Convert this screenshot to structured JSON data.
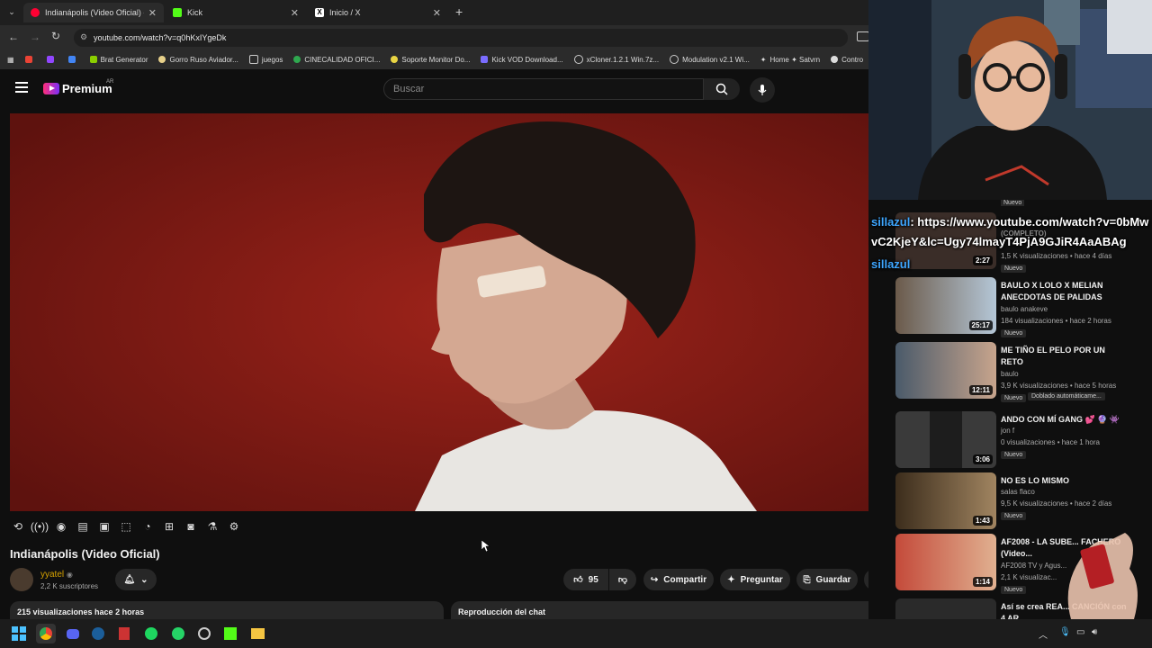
{
  "browser": {
    "tabs": [
      {
        "label": "Indianápolis (Video Oficial) - Yo",
        "active": true
      },
      {
        "label": "Kick",
        "active": false
      },
      {
        "label": "Inicio / X",
        "active": false
      }
    ],
    "url": "youtube.com/watch?v=q0hKxIYgeDk",
    "bookmarks": [
      "Brat Generator",
      "Gorro Ruso Aviador...",
      "juegos",
      "CINECALIDAD OFICI...",
      "Soporte Monitor Do...",
      "Kick VOD Download...",
      "xCloner.1.2.1 Win.7z...",
      "Modulation v2.1 Wi...",
      "Home ✦ Satvrn",
      "Contro"
    ]
  },
  "youtube": {
    "logo_text": "Premium",
    "region": "AR",
    "search_placeholder": "Buscar"
  },
  "video": {
    "title": "Indianápolis (Video Oficial)",
    "channel": "yyatel",
    "subscribers": "2,2 K suscriptores",
    "likes": "95",
    "share_label": "Compartir",
    "ask_label": "Preguntar",
    "save_label": "Guardar",
    "views_time": "215 visualizaciones  hace 2 horas",
    "chat_replay": "Reproducción del chat"
  },
  "chat_overlay": {
    "user": "sillazul",
    "message": ": https://www.youtube.com/watch?v=0bMwvC2KjeY&lc=Ugy74lmayT4PjA9GJiR4AaABAg",
    "user2": "sillazul"
  },
  "recommendations": [
    {
      "title": "",
      "channel": "",
      "meta": "1,5 K visualizaciones • hace 4 días",
      "duration": "2:27",
      "badge": "Nuevo",
      "partial_title": "(COMPLETO)"
    },
    {
      "title": "BAULO X LOLO X MELIAN ANECDOTAS DE PALIDAS",
      "channel": "baulo anakeve",
      "meta": "184 visualizaciones • hace 2 horas",
      "duration": "25:17",
      "badge": "Nuevo"
    },
    {
      "title": "ME TIÑO EL PELO POR UN RETO",
      "channel": "baulo",
      "meta": "3,9 K visualizaciones • hace 5 horas",
      "duration": "12:11",
      "badge": "Nuevo",
      "extra": "Doblado automáticame..."
    },
    {
      "title": "ANDO CON MÍ GANG 💕 🔮 👾",
      "channel": "jon f",
      "meta": "0 visualizaciones • hace 1 hora",
      "duration": "3:06",
      "badge": "Nuevo"
    },
    {
      "title": "NO ES LO MISMO",
      "channel": "salas flaco",
      "meta": "9,5 K visualizaciones • hace 2 días",
      "duration": "1:43",
      "badge": "Nuevo"
    },
    {
      "title": "AF2008 - LA SUBE... FACHERO (Video...",
      "channel": "AF2008 TV y Agus...",
      "meta": "2,1 K visualizac...",
      "duration": "1:14",
      "badge": "Nuevo"
    },
    {
      "title": "Así se crea REA... CANCIÓN con 4 AR...",
      "channel": "",
      "meta": "",
      "duration": "",
      "badge": ""
    }
  ],
  "top_badge": "Nuevo",
  "colors": {
    "accent": "#ff0033",
    "player_bg": "#8c1d16",
    "chat_user": "#3ea6ff"
  }
}
